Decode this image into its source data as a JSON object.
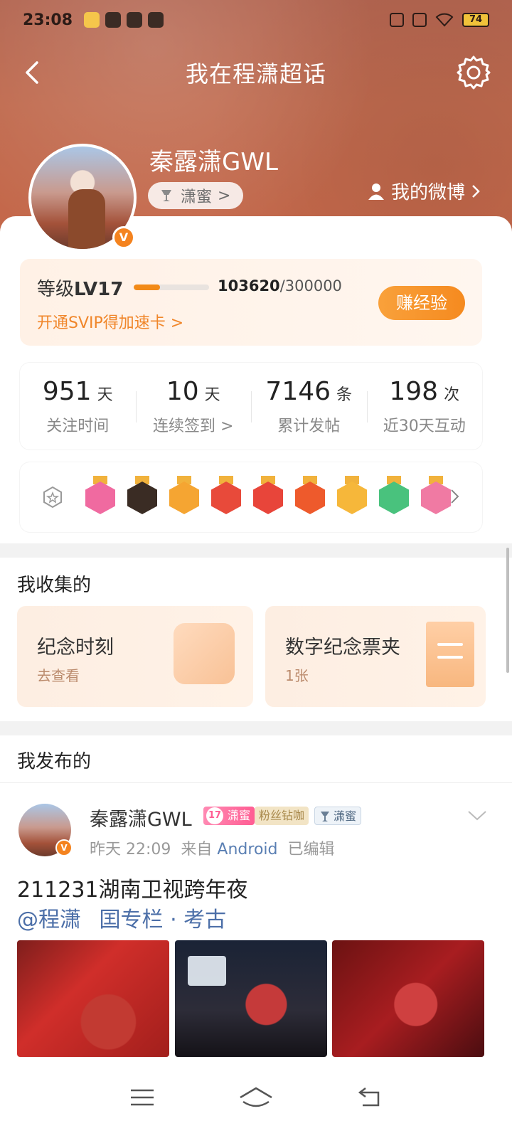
{
  "status_bar": {
    "time": "23:08",
    "battery": "74"
  },
  "nav": {
    "title": "我在程潇超话"
  },
  "profile": {
    "username": "秦露潇GWL",
    "fan_group": "潇蜜",
    "fan_group_arrow": ">",
    "my_weibo": "我的微博",
    "verified_mark": "V"
  },
  "level": {
    "label_prefix": "等级",
    "level": "LV17",
    "current_exp": "103620",
    "total_exp": "/300000",
    "progress": 0.3454,
    "svip_promo": "开通SVIP得加速卡 >",
    "earn_button": "赚经验"
  },
  "stats": [
    {
      "value": "951",
      "unit": "天",
      "label": "关注时间"
    },
    {
      "value": "10",
      "unit": "天",
      "label": "连续签到 >"
    },
    {
      "value": "7146",
      "unit": "条",
      "label": "累计发帖"
    },
    {
      "value": "198",
      "unit": "次",
      "label": "近30天互动"
    }
  ],
  "badges": {
    "colors": [
      "#f06aa0",
      "#3a2c24",
      "#f5a532",
      "#e84a3a",
      "#e8453a",
      "#ee5a2c",
      "#f6b73a",
      "#49c27d",
      "#f07aa3"
    ]
  },
  "collected": {
    "title": "我收集的",
    "cards": [
      {
        "title": "纪念时刻",
        "subtitle": "去查看"
      },
      {
        "title": "数字纪念票夹",
        "subtitle": "1张"
      }
    ]
  },
  "published": {
    "title": "我发布的",
    "post": {
      "author": "秦露潇GWL",
      "level_tag_num": "17",
      "level_tag": "潇蜜",
      "fan_tag": "粉丝钻咖",
      "group_tag": "潇蜜",
      "time": "昨天 22:09",
      "source_prefix": "来自",
      "source": "Android",
      "edited": "已编辑",
      "text": "211231湖南卫视跨年夜",
      "links": [
        "@程潇",
        "囯专栏 · 考古"
      ]
    }
  }
}
